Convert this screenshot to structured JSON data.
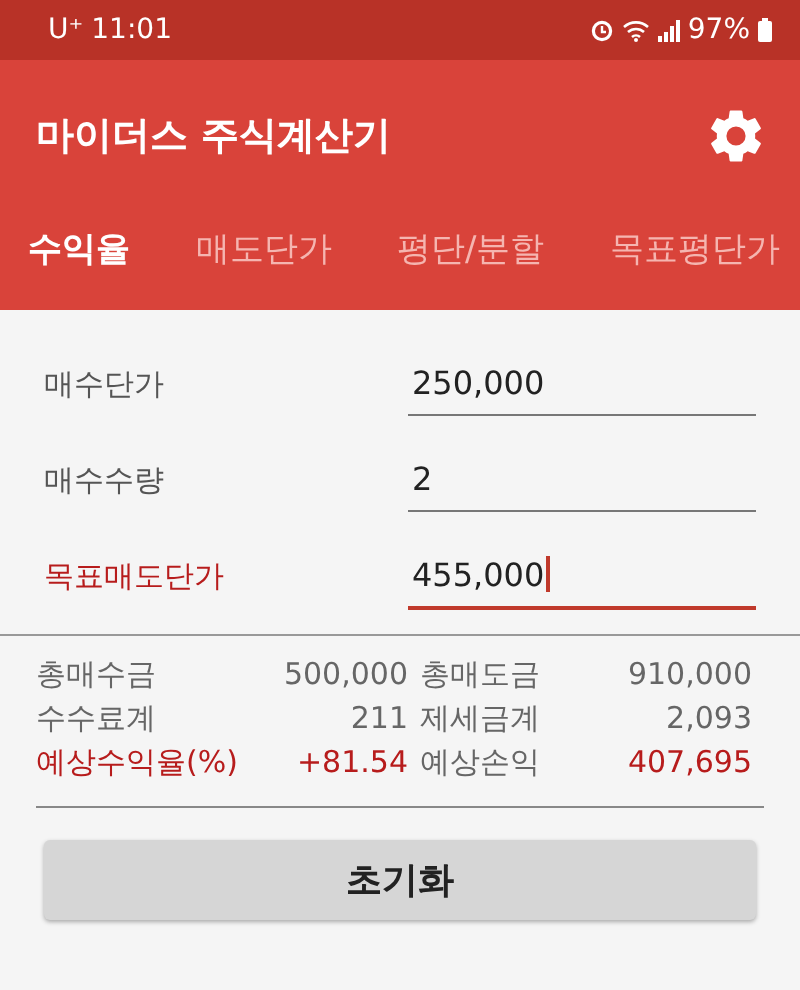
{
  "status_bar": {
    "carrier": "U⁺",
    "time": "11:01",
    "battery": "97%"
  },
  "app_bar": {
    "title": "마이더스 주식계산기"
  },
  "tabs": [
    {
      "label": "수익율",
      "selected": true
    },
    {
      "label": "매도단가",
      "selected": false
    },
    {
      "label": "평단/분할",
      "selected": false
    },
    {
      "label": "목표평단가",
      "selected": false
    }
  ],
  "fields": [
    {
      "label": "매수단가",
      "value": "250,000",
      "focused": false
    },
    {
      "label": "매수수량",
      "value": "2",
      "focused": false
    },
    {
      "label": "목표매도단가",
      "value": "455,000",
      "focused": true
    }
  ],
  "results": [
    [
      {
        "text": "총매수금",
        "highlight": false
      },
      {
        "text": "500,000",
        "highlight": false
      },
      {
        "text": "총매도금",
        "highlight": false
      },
      {
        "text": "910,000",
        "highlight": false
      }
    ],
    [
      {
        "text": "수수료계",
        "highlight": false
      },
      {
        "text": "211",
        "highlight": false
      },
      {
        "text": "제세금계",
        "highlight": false
      },
      {
        "text": "2,093",
        "highlight": false
      }
    ],
    [
      {
        "text": "예상수익율(%)",
        "highlight": true
      },
      {
        "text": "+81.54",
        "highlight": true
      },
      {
        "text": "예상손익",
        "highlight": false
      },
      {
        "text": "407,695",
        "highlight": true
      }
    ]
  ],
  "reset_button": "초기화"
}
